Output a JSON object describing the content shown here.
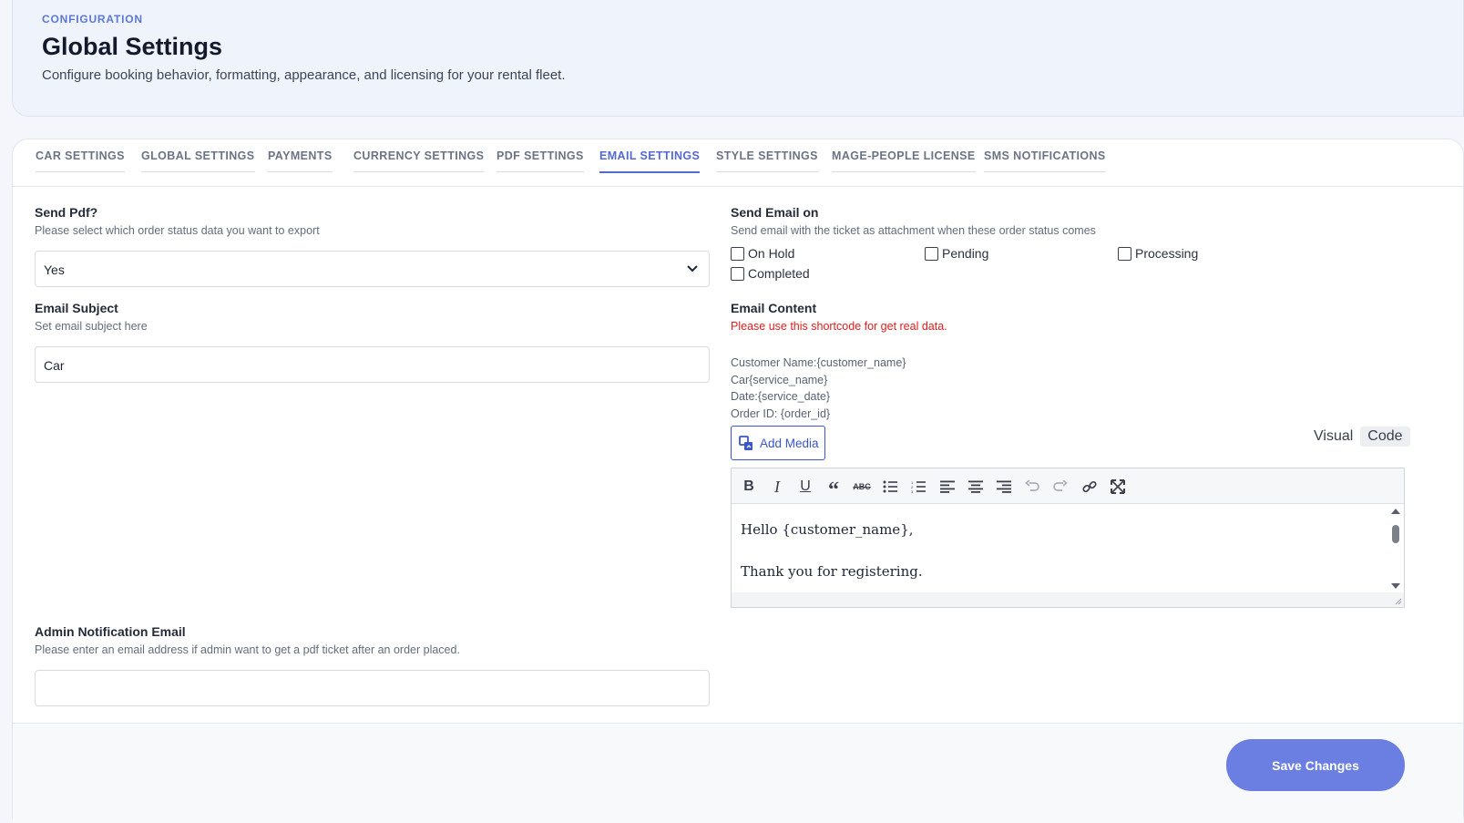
{
  "header": {
    "eyebrow": "CONFIGURATION",
    "title": "Global Settings",
    "subtitle": "Configure booking behavior, formatting, appearance, and licensing for your rental fleet."
  },
  "tabs": [
    {
      "label": "CAR SETTINGS"
    },
    {
      "label": "GLOBAL SETTINGS"
    },
    {
      "label": "PAYMENTS"
    },
    {
      "label": "CURRENCY SETTINGS"
    },
    {
      "label": "PDF SETTINGS"
    },
    {
      "label": "EMAIL SETTINGS",
      "active": true
    },
    {
      "label": "STYLE SETTINGS"
    },
    {
      "label": "MAGE-PEOPLE LICENSE"
    },
    {
      "label": "SMS NOTIFICATIONS"
    }
  ],
  "send_pdf": {
    "label": "Send Pdf?",
    "hint": "Please select which order status data you want to export",
    "value": "Yes"
  },
  "email_subject": {
    "label": "Email Subject",
    "hint": "Set email subject here",
    "value": "Car"
  },
  "admin_email": {
    "label": "Admin Notification Email",
    "hint": "Please enter an email address if admin want to get a pdf ticket after an order placed.",
    "value": ""
  },
  "send_email_on": {
    "label": "Send Email on",
    "hint": "Send email with the ticket as attachment when these order status comes",
    "options": [
      {
        "label": "On Hold",
        "checked": false
      },
      {
        "label": "Pending",
        "checked": false
      },
      {
        "label": "Processing",
        "checked": false
      },
      {
        "label": "Completed",
        "checked": false
      }
    ]
  },
  "email_content": {
    "label": "Email Content",
    "hint": "Please use this shortcode for get real data.",
    "shortcodes": [
      "Customer Name:{customer_name}",
      "Car{service_name}",
      "Date:{service_date}",
      "Order ID: {order_id}"
    ],
    "add_media": "Add Media",
    "mode_visual": "Visual",
    "mode_code": "Code",
    "body_lines": [
      "Hello {customer_name},",
      "",
      "Thank you for registering."
    ]
  },
  "toolbar_icons": [
    "bold-icon",
    "italic-icon",
    "underline-icon",
    "blockquote-icon",
    "strikethrough-icon",
    "bullet-list-icon",
    "numbered-list-icon",
    "align-left-icon",
    "align-center-icon",
    "align-right-icon",
    "undo-icon",
    "redo-icon",
    "link-icon",
    "fullscreen-icon"
  ],
  "footer": {
    "save_label": "Save Changes"
  },
  "colors": {
    "accent": "#5468d4",
    "save_button": "#6b7fe3",
    "hint_red": "#e21c1c",
    "header_bg": "#eef3fc"
  }
}
